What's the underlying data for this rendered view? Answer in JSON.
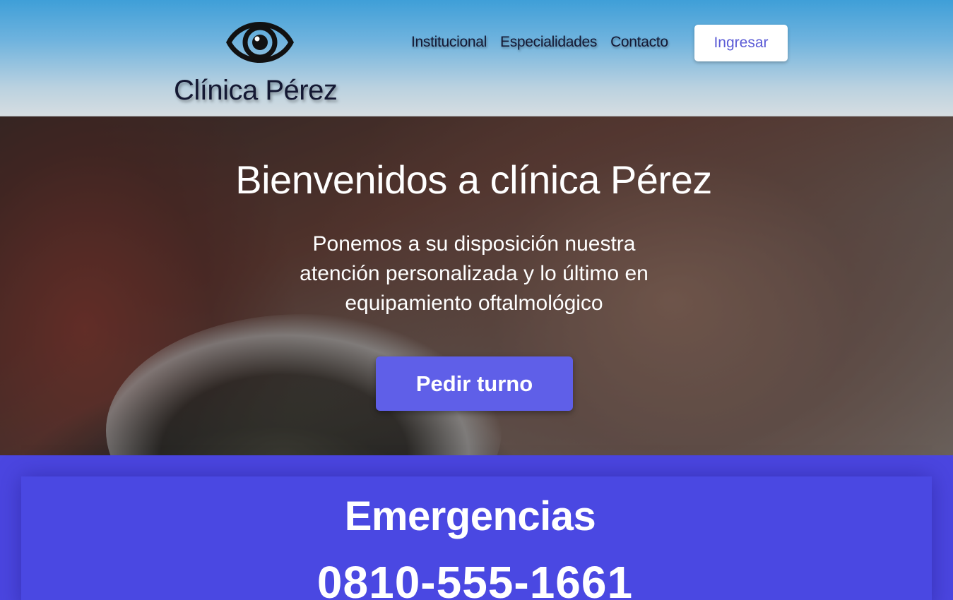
{
  "header": {
    "brand": "Clínica Pérez",
    "nav": [
      {
        "label": "Institucional"
      },
      {
        "label": "Especialidades"
      },
      {
        "label": "Contacto"
      }
    ],
    "login_label": "Ingresar"
  },
  "hero": {
    "title": "Bienvenidos a clínica Pérez",
    "subtitle": "Ponemos a su disposición nuestra atención personalizada y lo último en equipamiento oftalmológico",
    "cta_label": "Pedir turno"
  },
  "emergency": {
    "title": "Emergencias",
    "phone": "0810-555-1661"
  },
  "colors": {
    "accent": "#5f5fe8",
    "emergency_bg": "#4b46e0",
    "header_top": "#3f9fd8",
    "text_dark": "#141833"
  },
  "icons": {
    "logo": "eye-icon"
  }
}
